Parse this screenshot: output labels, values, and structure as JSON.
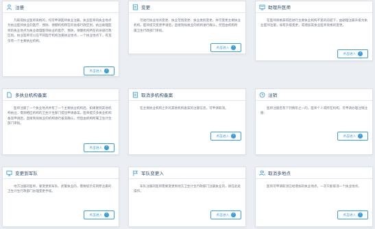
{
  "accent_color": "#3a9de0",
  "cards": [
    {
      "title": "注册",
      "icon": "person-icon",
      "description": "凡取得执业医师资格的，均可申请医师执业注册。执业医师的执业地点为执业医师执业的医疗、预防、保健机构所在的省级行政区划，执业助理医师的执业地点为执业助理医师执业的医疗、预防、保健机构所在的县级行政区划。执业医师可以在不同医疗机构注册执业地点，一个执业地点下，有且仅有一个主要执业机构。",
      "button": "点击进入"
    },
    {
      "title": "变更",
      "icon": "document-icon",
      "description": "可进行执业地点变更、执业范围变更、执业类别变更，并可变更主要执业机构。医师提交变更申请后，直接到拟执业的机构进行确认，然后由机构所属卫生行政部门审核。",
      "button": "点击进入"
    },
    {
      "title": "助理升医师",
      "icon": "certificate-icon",
      "description": "在医师资格获得后进行主要执业机构不变的前提下，由助理注册升级为执业医师注册，如有升级变更，或增加其执业医师资格的变更。",
      "button": "点击进入"
    },
    {
      "title": "多执业机构备案",
      "icon": "file-icon",
      "description": "医师注册了一个执业地点并有了一个主要执业机构后，如果要到其他机构执业，需到相应机构的卫生计生部门提出申请备案。医师提交多执业机构备案申请后，直接到拟执业的机构进行备案确认，然后由机构所属卫生计生部门审核。",
      "button": "点击进入"
    },
    {
      "title": "取消多机构备案",
      "icon": "document-icon",
      "description": "在主要执业机构之外的其他机构备案的注册信息，可申请取消。",
      "button": "点击进入"
    },
    {
      "title": "注销",
      "icon": "clock-icon",
      "description": "医师注册后有下列情形之一的，医师个人或所在机构，可申请办理注销注册：",
      "button": "点击进入"
    },
    {
      "title": "变更到军队",
      "icon": "screen-icon",
      "description": "地方注册的医师，要变更到军队、武警执业的，需要提示先到原注册的卫生计生行政部门办理变更手续。",
      "button": "点击进入"
    },
    {
      "title": "军队变更入",
      "icon": "flag-icon",
      "description": "军队注册的医师需要变更到地方卫生计生行政部门注册执业的，请在此处操作。",
      "button": "点击进入"
    },
    {
      "title": "取消多地点",
      "icon": "people-icon",
      "description": "医师可申请取消已经增加的执业地点，一次只能取消一个执业地点。",
      "button": "点击进入"
    }
  ]
}
